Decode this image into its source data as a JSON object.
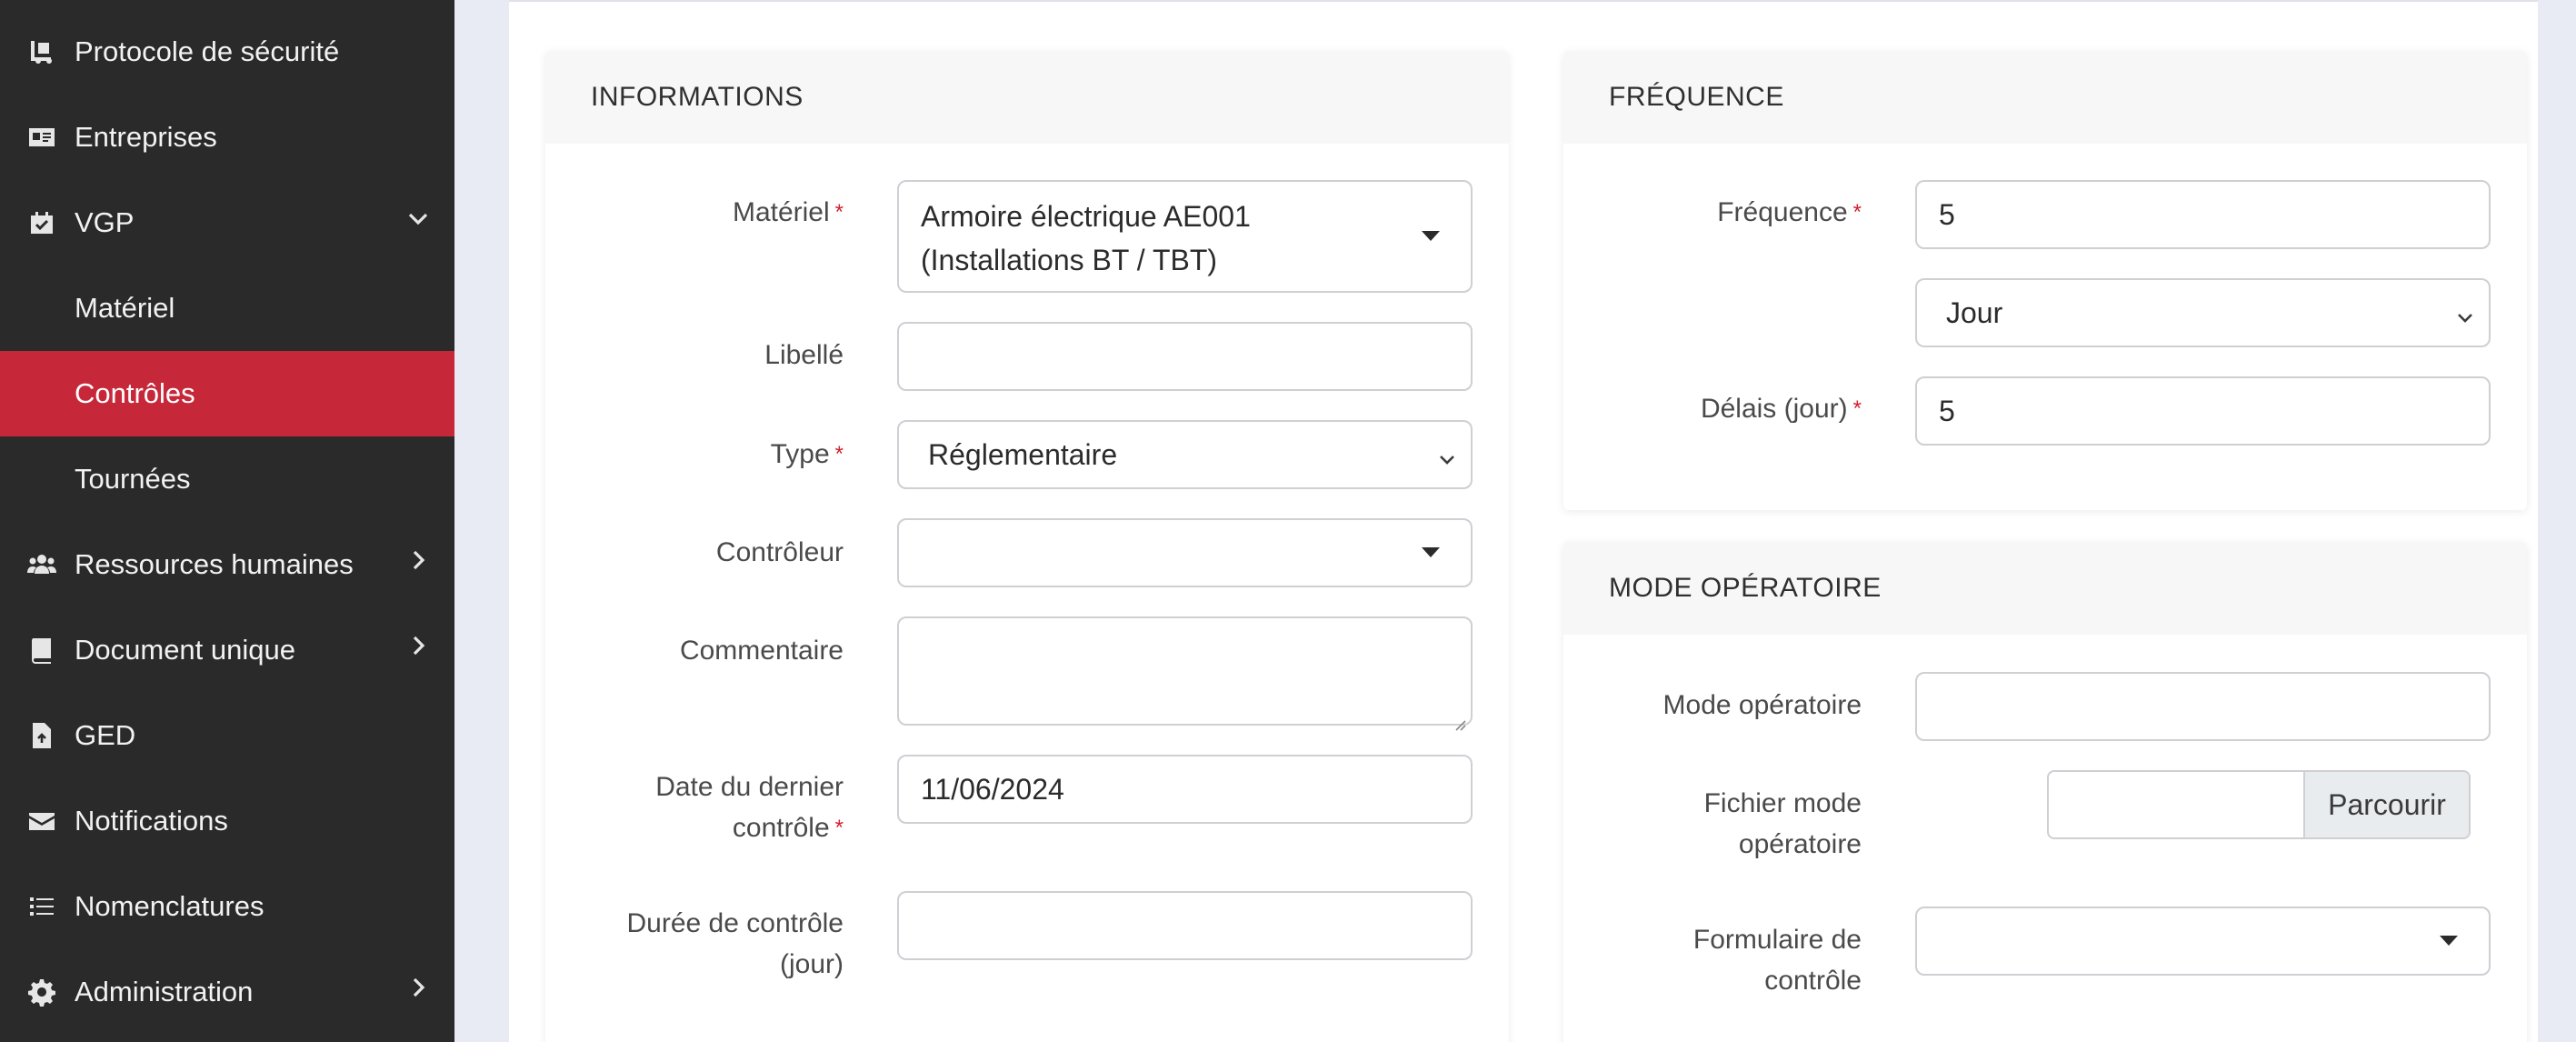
{
  "sidebar": {
    "items": [
      {
        "label": "Protocole de sécurité",
        "icon": "truck-loading-icon"
      },
      {
        "label": "Entreprises",
        "icon": "id-card-icon"
      },
      {
        "label": "VGP",
        "icon": "calendar-check-icon"
      },
      {
        "label": "Ressources humaines",
        "icon": "users-icon"
      },
      {
        "label": "Document unique",
        "icon": "book-icon"
      },
      {
        "label": "GED",
        "icon": "file-upload-icon"
      },
      {
        "label": "Notifications",
        "icon": "envelope-icon"
      },
      {
        "label": "Nomenclatures",
        "icon": "list-icon"
      },
      {
        "label": "Administration",
        "icon": "gear-icon"
      }
    ],
    "vgp_subitems": [
      {
        "label": "Matériel"
      },
      {
        "label": "Contrôles"
      },
      {
        "label": "Tournées"
      }
    ],
    "active_subitem": "Contrôles",
    "accent_color": "#c6283a",
    "background_color": "#2a2a2a"
  },
  "informations": {
    "title": "INFORMATIONS",
    "materiel": {
      "label": "Matériel",
      "value_line1": "Armoire électrique AE001",
      "value_line2": "(Installations BT / TBT)"
    },
    "libelle": {
      "label": "Libellé",
      "value": ""
    },
    "type": {
      "label": "Type",
      "value": "Réglementaire"
    },
    "controleur": {
      "label": "Contrôleur",
      "value": ""
    },
    "commentaire": {
      "label": "Commentaire",
      "value": ""
    },
    "date_dernier": {
      "label_line1": "Date du dernier",
      "label_line2": "contrôle",
      "value": "11/06/2024"
    },
    "duree": {
      "label_line1": "Durée de contrôle",
      "label_line2": "(jour)",
      "value": ""
    }
  },
  "frequence": {
    "title": "FRÉQUENCE",
    "frequence": {
      "label": "Fréquence",
      "value": "5"
    },
    "unite": {
      "value": "Jour"
    },
    "delais": {
      "label": "Délais (jour)",
      "value": "5"
    }
  },
  "mode_operatoire": {
    "title": "MODE OPÉRATOIRE",
    "mode": {
      "label": "Mode opératoire",
      "value": ""
    },
    "fichier": {
      "label_line1": "Fichier mode",
      "label_line2": "opératoire",
      "button": "Parcourir"
    },
    "formulaire": {
      "label_line1": "Formulaire de",
      "label_line2": "contrôle",
      "value": ""
    }
  },
  "required_marker": "*"
}
